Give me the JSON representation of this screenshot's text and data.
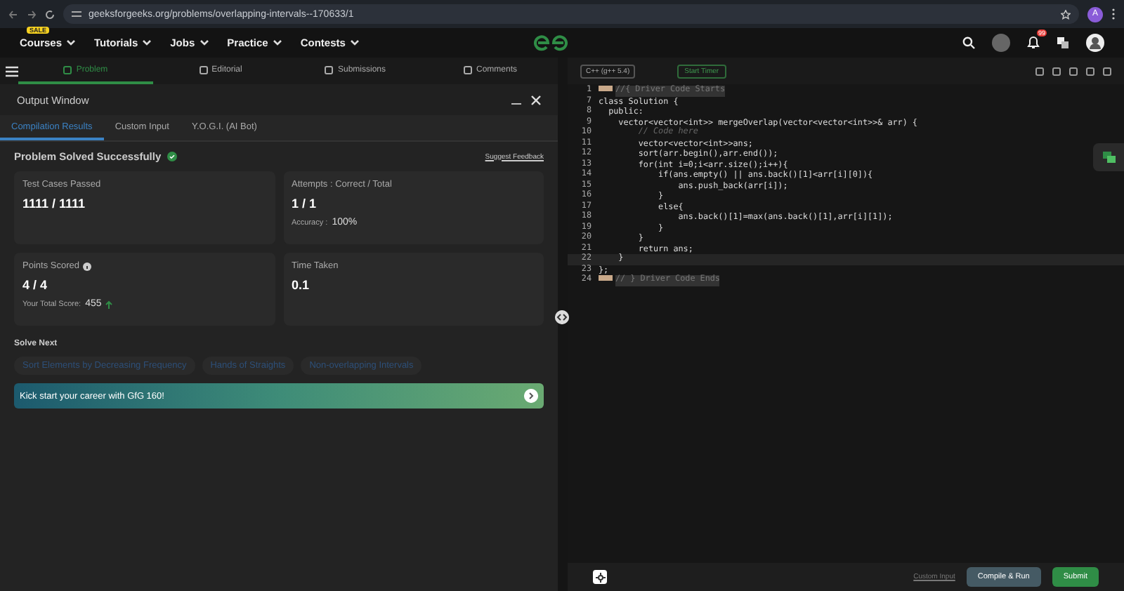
{
  "browser": {
    "url": "geeksforgeeks.org/problems/overlapping-intervals--170633/1",
    "profile": "A"
  },
  "nav": {
    "items": [
      {
        "label": "Courses",
        "badge": "SALE"
      },
      {
        "label": "Tutorials"
      },
      {
        "label": "Jobs"
      },
      {
        "label": "Practice"
      },
      {
        "label": "Contests"
      }
    ],
    "notifications": "99"
  },
  "tabs": [
    {
      "label": "Problem",
      "selected": true
    },
    {
      "label": "Editorial",
      "selected": false
    },
    {
      "label": "Submissions",
      "selected": false
    },
    {
      "label": "Comments",
      "selected": false
    }
  ],
  "output": {
    "title": "Output Window",
    "tabs": [
      {
        "label": "Compilation Results",
        "selected": true
      },
      {
        "label": "Custom Input",
        "selected": false
      },
      {
        "label": "Y.O.G.I. (AI Bot)",
        "selected": false
      }
    ],
    "status": "Problem Solved Successfully",
    "feedback": "Suggest Feedback",
    "cards": [
      {
        "title": "Test Cases Passed",
        "value": "1111 / 1111"
      },
      {
        "title": "Attempts : Correct / Total",
        "value": "1 / 1",
        "note_label": "Accuracy :",
        "note_value": "100%"
      },
      {
        "title": "Points Scored",
        "value": "4 / 4",
        "info": true,
        "note_label": "Your Total Score:",
        "note_value": "455",
        "trend_up": true
      },
      {
        "title": "Time Taken",
        "value": "0.1"
      }
    ],
    "solve_next": "Solve Next",
    "suggestions": [
      "Sort Elements by Decreasing Frequency",
      "Hands of Straights",
      "Non-overlapping Intervals"
    ],
    "banner": "Kick start your career with GfG 160!"
  },
  "editor": {
    "language": "C++ (g++ 5.4)",
    "timer": "Start Timer",
    "lines": [
      {
        "number": "1",
        "text": "//{ Driver Code Starts",
        "kind": "folded"
      },
      {
        "number": "7",
        "text": "class Solution {",
        "kind": "code"
      },
      {
        "number": "8",
        "text": "  public:",
        "kind": "code"
      },
      {
        "number": "9",
        "text": "    vector<vector<int>> mergeOverlap(vector<vector<int>>& arr) {",
        "kind": "code"
      },
      {
        "number": "10",
        "text": "        // Code here",
        "kind": "comment"
      },
      {
        "number": "11",
        "text": "        vector<vector<int>>ans;",
        "kind": "code"
      },
      {
        "number": "12",
        "text": "        sort(arr.begin(),arr.end());",
        "kind": "code"
      },
      {
        "number": "13",
        "text": "        for(int i=0;i<arr.size();i++){",
        "kind": "code"
      },
      {
        "number": "14",
        "text": "            if(ans.empty() || ans.back()[1]<arr[i][0]){",
        "kind": "code"
      },
      {
        "number": "15",
        "text": "                ans.push_back(arr[i]);",
        "kind": "code"
      },
      {
        "number": "16",
        "text": "            }",
        "kind": "code"
      },
      {
        "number": "17",
        "text": "            else{",
        "kind": "code"
      },
      {
        "number": "18",
        "text": "                ans.back()[1]=max(ans.back()[1],arr[i][1]);",
        "kind": "code"
      },
      {
        "number": "19",
        "text": "            }",
        "kind": "code"
      },
      {
        "number": "20",
        "text": "        }",
        "kind": "code"
      },
      {
        "number": "21",
        "text": "        return ans;",
        "kind": "code"
      },
      {
        "number": "22",
        "text": "    }",
        "kind": "current"
      },
      {
        "number": "23",
        "text": "};",
        "kind": "code"
      },
      {
        "number": "24",
        "text": "// } Driver Code Ends",
        "kind": "folded"
      }
    ],
    "custom_input": "Custom Input",
    "run": "Compile & Run",
    "submit": "Submit"
  }
}
